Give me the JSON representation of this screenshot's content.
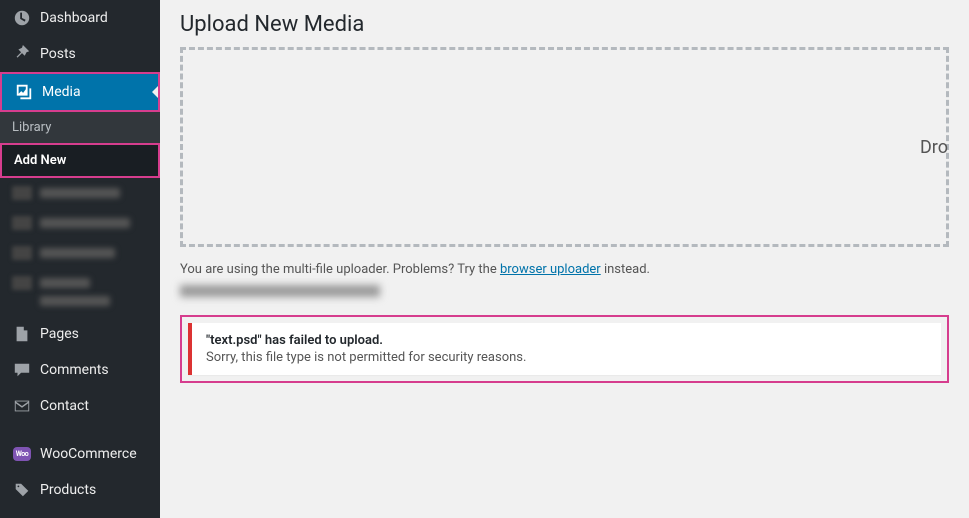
{
  "sidebar": {
    "items": [
      {
        "label": "Dashboard"
      },
      {
        "label": "Posts"
      },
      {
        "label": "Media"
      },
      {
        "label": "Pages"
      },
      {
        "label": "Comments"
      },
      {
        "label": "Contact"
      },
      {
        "label": "WooCommerce"
      },
      {
        "label": "Products"
      }
    ],
    "subitems": [
      {
        "label": "Library"
      },
      {
        "label": "Add New"
      }
    ]
  },
  "main": {
    "title": "Upload New Media",
    "dropzone_text": "Dro",
    "uploader_note_prefix": "You are using the multi-file uploader. Problems? Try the ",
    "uploader_note_link": "browser uploader",
    "uploader_note_suffix": " instead.",
    "error": {
      "title": "\"text.psd\" has failed to upload.",
      "message": "Sorry, this file type is not permitted for security reasons."
    }
  }
}
